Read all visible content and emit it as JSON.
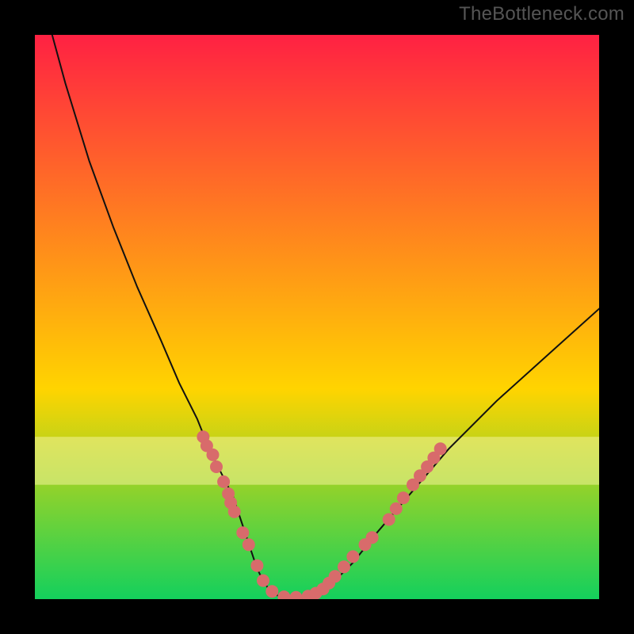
{
  "watermark": "TheBottleneck.com",
  "chart_data": {
    "type": "line",
    "title": "",
    "xlabel": "",
    "ylabel": "",
    "xlim": [
      0,
      100
    ],
    "ylim": [
      0,
      100
    ],
    "background_gradient": {
      "top": "#ff1846",
      "mid": "#ffd400",
      "bottom": "#00d064"
    },
    "border_color": "#000000",
    "series": [
      {
        "name": "bottleneck-curve",
        "type": "curve",
        "color": "#111111",
        "x": [
          5,
          8,
          12,
          16,
          20,
          24,
          27,
          30,
          32,
          34,
          36,
          37,
          38,
          39,
          40,
          41,
          42,
          43,
          44,
          46,
          48,
          50,
          53,
          56,
          60,
          66,
          72,
          80,
          90,
          100
        ],
        "y": [
          100,
          89,
          76,
          65,
          55,
          46,
          39,
          33,
          28,
          24,
          20,
          17,
          14,
          11,
          8,
          6,
          4.5,
          3.7,
          3.3,
          3.2,
          3.3,
          4.0,
          6,
          9,
          14,
          21,
          28,
          36,
          45,
          54
        ]
      },
      {
        "name": "threshold-band",
        "type": "band",
        "color": "#f3f39a",
        "y_range": [
          22,
          30
        ]
      },
      {
        "name": "highlight-dots",
        "type": "scatter",
        "color": "#d86b6b",
        "dot_radius_px": 8,
        "points": [
          {
            "x": 31.0,
            "y": 30.0
          },
          {
            "x": 31.6,
            "y": 28.5
          },
          {
            "x": 32.6,
            "y": 27.0
          },
          {
            "x": 33.2,
            "y": 25.0
          },
          {
            "x": 34.4,
            "y": 22.5
          },
          {
            "x": 35.2,
            "y": 20.5
          },
          {
            "x": 35.6,
            "y": 19.0
          },
          {
            "x": 36.2,
            "y": 17.5
          },
          {
            "x": 37.6,
            "y": 14.0
          },
          {
            "x": 38.6,
            "y": 12.0
          },
          {
            "x": 40.0,
            "y": 8.5
          },
          {
            "x": 41.0,
            "y": 6.0
          },
          {
            "x": 42.5,
            "y": 4.2
          },
          {
            "x": 44.5,
            "y": 3.3
          },
          {
            "x": 46.5,
            "y": 3.2
          },
          {
            "x": 48.5,
            "y": 3.4
          },
          {
            "x": 49.8,
            "y": 3.9
          },
          {
            "x": 51.0,
            "y": 4.6
          },
          {
            "x": 52.0,
            "y": 5.6
          },
          {
            "x": 53.0,
            "y": 6.7
          },
          {
            "x": 54.5,
            "y": 8.3
          },
          {
            "x": 56.0,
            "y": 10.0
          },
          {
            "x": 58.0,
            "y": 12.0
          },
          {
            "x": 59.2,
            "y": 13.2
          },
          {
            "x": 62.0,
            "y": 16.2
          },
          {
            "x": 63.2,
            "y": 18.0
          },
          {
            "x": 64.4,
            "y": 19.8
          },
          {
            "x": 66.0,
            "y": 22.0
          },
          {
            "x": 67.2,
            "y": 23.5
          },
          {
            "x": 68.4,
            "y": 25.0
          },
          {
            "x": 69.5,
            "y": 26.5
          },
          {
            "x": 70.6,
            "y": 28.0
          }
        ]
      }
    ]
  }
}
